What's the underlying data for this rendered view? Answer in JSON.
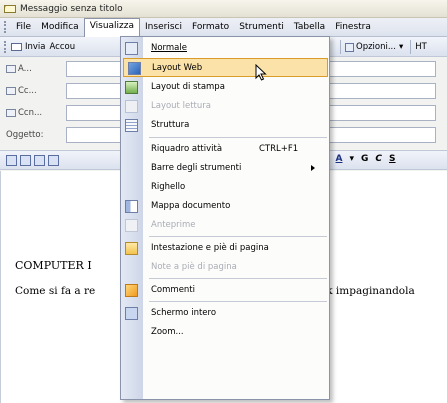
{
  "window": {
    "title": "Messaggio senza titolo"
  },
  "menubar": {
    "items": [
      "File",
      "Modifica",
      "Visualizza",
      "Inserisci",
      "Formato",
      "Strumenti",
      "Tabella",
      "Finestra"
    ]
  },
  "toolbar": {
    "send_label": "Invia",
    "account_label": "Accou",
    "options_label": "Opzioni...",
    "html_label": "HT"
  },
  "fields": {
    "to_label": "A...",
    "cc_label": "Cc...",
    "bcc_label": "Ccn...",
    "subject_label": "Oggetto:"
  },
  "format_toolbar": {
    "font_color_label": "A",
    "bold_label": "G",
    "italic_label": "C",
    "underline_label": "S"
  },
  "menu": {
    "items": [
      {
        "label": "Normale",
        "icon": "normal-view-icon"
      },
      {
        "label": "Layout Web",
        "icon": "web-layout-icon",
        "highlighted": true
      },
      {
        "label": "Layout di stampa",
        "icon": "print-layout-icon"
      },
      {
        "label": "Layout lettura",
        "icon": "reading-layout-icon",
        "disabled": true
      },
      {
        "label": "Struttura",
        "icon": "outline-icon"
      },
      {
        "label": "Riquadro attività",
        "shortcut": "CTRL+F1"
      },
      {
        "label": "Barre degli strumenti",
        "submenu": true
      },
      {
        "label": "Righello"
      },
      {
        "label": "Mappa documento",
        "icon": "document-map-icon"
      },
      {
        "label": "Anteprime",
        "icon": "thumbnails-icon",
        "disabled": true
      },
      {
        "label": "Intestazione e piè di pagina",
        "icon": "header-footer-icon"
      },
      {
        "label": "Note a piè di pagina",
        "disabled": true
      },
      {
        "label": "Commenti",
        "icon": "comments-icon"
      },
      {
        "label": "Schermo intero",
        "icon": "full-screen-icon"
      },
      {
        "label": "Zoom..."
      }
    ]
  },
  "document": {
    "heading": "COMPUTER I",
    "body_left": "Come si fa a re",
    "body_right": "tlook impaginandola"
  },
  "colors": {
    "highlight_bg": "#fbe2a8",
    "highlight_border": "#d99c2a",
    "menu_icon_strip": "#cdd6e8"
  }
}
